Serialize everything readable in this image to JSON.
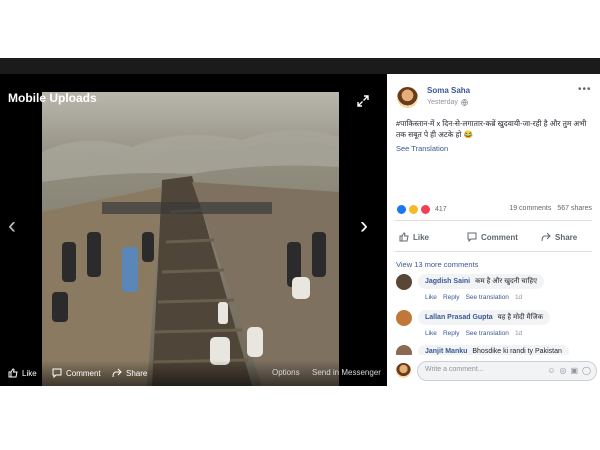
{
  "viewer": {
    "title": "Mobile Uploads",
    "options_label": "Options",
    "messenger_label": "Send in Messenger",
    "actions": {
      "like": "Like",
      "comment": "Comment",
      "share": "Share"
    }
  },
  "post": {
    "author": "Soma Saha",
    "time": "Yesterday",
    "text": "#पाकिस्तान-में x दिन-से-लगातार-कब्रें खुदवायी-जा-रही है और तुम अभी तक सबूत पे ही अटके हो 😂",
    "see_translation": "See Translation",
    "reaction_count": "417",
    "comments_count": "19 comments",
    "shares_count": "567 shares",
    "buttons": {
      "like": "Like",
      "comment": "Comment",
      "share": "Share"
    },
    "view_more_comments": "View 13 more comments"
  },
  "comments": [
    {
      "name": "Jagdish Saini",
      "text": "कम है और खुदनी चाहिए",
      "like": "Like",
      "reply": "Reply",
      "see_translation": "See translation",
      "time": "1d"
    },
    {
      "name": "Lallan Prasad Gupta",
      "text": "यह है मोदी मैजिक",
      "like": "Like",
      "reply": "Reply",
      "see_translation": "See translation",
      "time": "1d"
    },
    {
      "name": "Janjit Manku",
      "text": "Bhosdike ki randi ty Pakistan",
      "like": "",
      "reply": "",
      "see_translation": "",
      "time": ""
    }
  ],
  "composer": {
    "placeholder": "Write a comment..."
  }
}
